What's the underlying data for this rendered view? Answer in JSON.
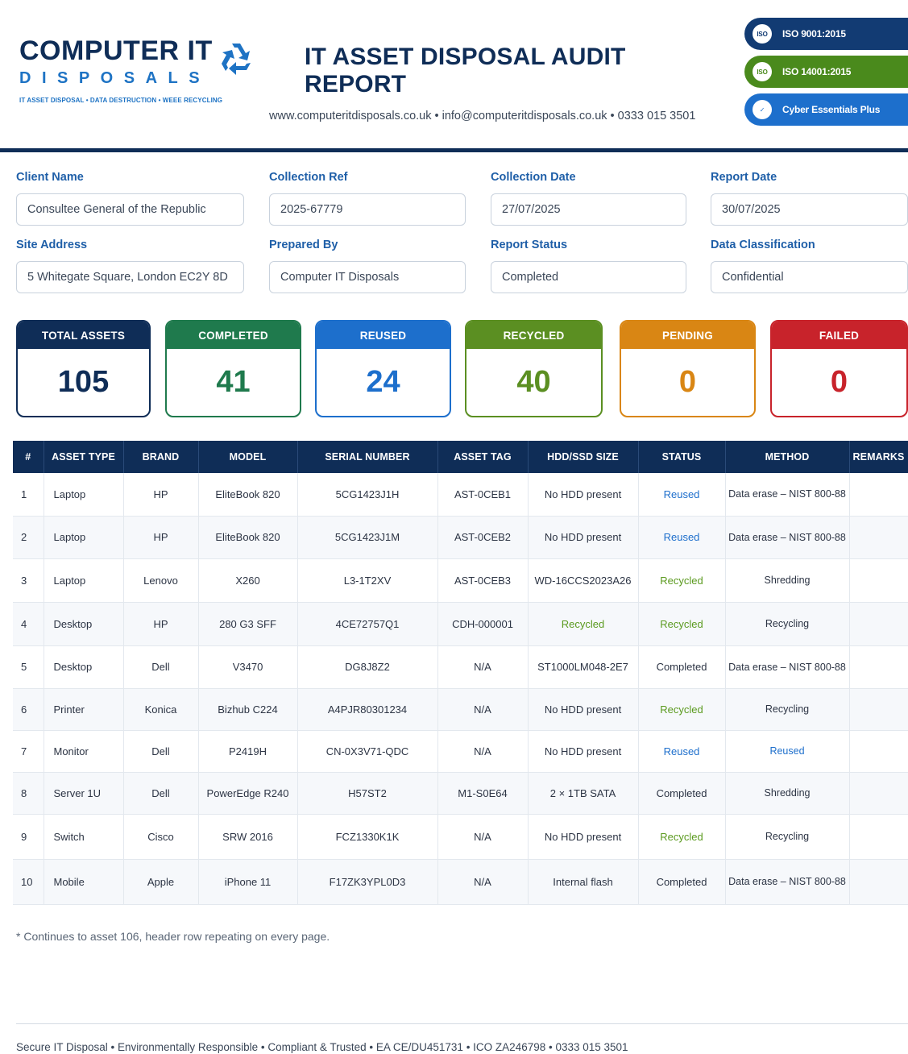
{
  "header": {
    "logo_main": "COMPUTER IT",
    "logo_sub": "DISPOSALS",
    "logo_tagline": "IT ASSET DISPOSAL • DATA DESTRUCTION • WEEE RECYCLING",
    "report_title": "IT ASSET DISPOSAL AUDIT REPORT",
    "contact_line": "www.computeritdisposals.co.uk • info@computeritdisposals.co.uk • 0333 015 3501"
  },
  "badges": [
    {
      "label": "ISO 9001:2015",
      "icon_text": "ISO",
      "icon": "iso-icon",
      "color": "#123b73"
    },
    {
      "label": "ISO 14001:2015",
      "icon_text": "ISO",
      "icon": "iso-icon",
      "color": "#4a8a1c"
    },
    {
      "label": "Cyber Essentials Plus",
      "icon_text": "✓",
      "icon": "shield-check-icon",
      "color": "#1d6fcc"
    }
  ],
  "fields": {
    "client_name": {
      "label": "Client Name",
      "value": "Consultee General of the Republic"
    },
    "collection_ref": {
      "label": "Collection Ref",
      "value": "2025-67779"
    },
    "collection_date": {
      "label": "Collection Date",
      "value": "27/07/2025"
    },
    "report_date": {
      "label": "Report Date",
      "value": "30/07/2025"
    },
    "site_address": {
      "label": "Site Address",
      "value": "5 Whitegate Square, London EC2Y 8D"
    },
    "prepared_by": {
      "label": "Prepared By",
      "value": "Computer IT Disposals"
    },
    "report_status": {
      "label": "Report Status",
      "value": "Completed"
    },
    "data_classification": {
      "label": "Data Classification",
      "value": "Confidential"
    }
  },
  "stats": [
    {
      "label": "TOTAL ASSETS",
      "value": "105",
      "color": "#0f2d57",
      "value_color": "#0f2d57"
    },
    {
      "label": "COMPLETED",
      "value": "41",
      "color": "#1f7a4d",
      "value_color": "#1f7a4d"
    },
    {
      "label": "REUSED",
      "value": "24",
      "color": "#1d6fcc",
      "value_color": "#1d6fcc"
    },
    {
      "label": "RECYCLED",
      "value": "40",
      "color": "#5b8f22",
      "value_color": "#5b8f22"
    },
    {
      "label": "PENDING",
      "value": "0",
      "color": "#d98614",
      "value_color": "#d98614"
    },
    {
      "label": "FAILED",
      "value": "0",
      "color": "#c8232b",
      "value_color": "#c8232b"
    }
  ],
  "table": {
    "headers": [
      "#",
      "ASSET TYPE",
      "BRAND",
      "MODEL",
      "SERIAL NUMBER",
      "ASSET TAG",
      "HDD/SSD SIZE",
      "STATUS",
      "METHOD",
      "REMARKS"
    ],
    "rows": [
      {
        "num": "1",
        "type": "Laptop",
        "brand": "HP",
        "model": "EliteBook 820",
        "serial": "5CG1423J1H",
        "tag": "AST-0CEB1",
        "hdd": "No HDD present",
        "hdd_tone": "plain",
        "status": "Reused",
        "status_tone": "blue",
        "method": "Data erase – NIST 800-88",
        "method_tone": "plain",
        "remarks": ""
      },
      {
        "num": "2",
        "type": "Laptop",
        "brand": "HP",
        "model": "EliteBook 820",
        "serial": "5CG1423J1M",
        "tag": "AST-0CEB2",
        "hdd": "No HDD present",
        "hdd_tone": "plain",
        "status": "Reused",
        "status_tone": "blue",
        "method": "Data erase – NIST 800-88",
        "method_tone": "plain",
        "remarks": ""
      },
      {
        "num": "3",
        "type": "Laptop",
        "brand": "Lenovo",
        "model": "X260",
        "serial": "L3-1T2XV",
        "tag": "AST-0CEB3",
        "hdd": "WD-16CCS2023A26",
        "hdd_tone": "plain",
        "status": "Recycled",
        "status_tone": "green",
        "method": "Shredding",
        "method_tone": "plain",
        "remarks": ""
      },
      {
        "num": "4",
        "type": "Desktop",
        "brand": "HP",
        "model": "280 G3 SFF",
        "serial": "4CE72757Q1",
        "tag": "CDH-000001",
        "hdd": "Recycled",
        "hdd_tone": "green",
        "status": "Recycled",
        "status_tone": "green",
        "method": "Recycling",
        "method_tone": "plain",
        "remarks": ""
      },
      {
        "num": "5",
        "type": "Desktop",
        "brand": "Dell",
        "model": "V3470",
        "serial": "DG8J8Z2",
        "tag": "N/A",
        "hdd": "ST1000LM048-2E7",
        "hdd_tone": "plain",
        "status": "Completed",
        "status_tone": "plain",
        "method": "Data erase – NIST 800-88",
        "method_tone": "plain",
        "remarks": ""
      },
      {
        "num": "6",
        "type": "Printer",
        "brand": "Konica",
        "model": "Bizhub C224",
        "serial": "A4PJR80301234",
        "tag": "N/A",
        "hdd": "No HDD present",
        "hdd_tone": "plain",
        "status": "Recycled",
        "status_tone": "green",
        "method": "Recycling",
        "method_tone": "plain",
        "remarks": ""
      },
      {
        "num": "7",
        "type": "Monitor",
        "brand": "Dell",
        "model": "P2419H",
        "serial": "CN-0X3V71-QDC",
        "tag": "N/A",
        "hdd": "No HDD present",
        "hdd_tone": "plain",
        "status": "Reused",
        "status_tone": "blue",
        "method": "Reused",
        "method_tone": "blue",
        "remarks": ""
      },
      {
        "num": "8",
        "type": "Server 1U",
        "brand": "Dell",
        "model": "PowerEdge R240",
        "serial": "H57ST2",
        "tag": "M1-S0E64",
        "hdd": "2 × 1TB SATA",
        "hdd_tone": "plain",
        "status": "Completed",
        "status_tone": "plain",
        "method": "Shredding",
        "method_tone": "plain",
        "remarks": ""
      },
      {
        "num": "9",
        "type": "Switch",
        "brand": "Cisco",
        "model": "SRW 2016",
        "serial": "FCZ1330K1K",
        "tag": "N/A",
        "hdd": "No HDD present",
        "hdd_tone": "plain",
        "status": "Recycled",
        "status_tone": "green",
        "method": "Recycling",
        "method_tone": "plain",
        "remarks": ""
      },
      {
        "num": "10",
        "type": "Mobile",
        "brand": "Apple",
        "model": "iPhone 11",
        "serial": "F17ZK3YPL0D3",
        "tag": "N/A",
        "hdd": "Internal flash",
        "hdd_tone": "plain",
        "status": "Completed",
        "status_tone": "plain",
        "method": "Data erase – NIST 800-88",
        "method_tone": "plain",
        "remarks": ""
      }
    ]
  },
  "footnote": "* Continues to asset 106, header row repeating on every page.",
  "footer": "Secure IT Disposal • Environmentally Responsible • Compliant & Trusted • EA CE/DU451731 • ICO ZA246798 • 0333 015 3501"
}
